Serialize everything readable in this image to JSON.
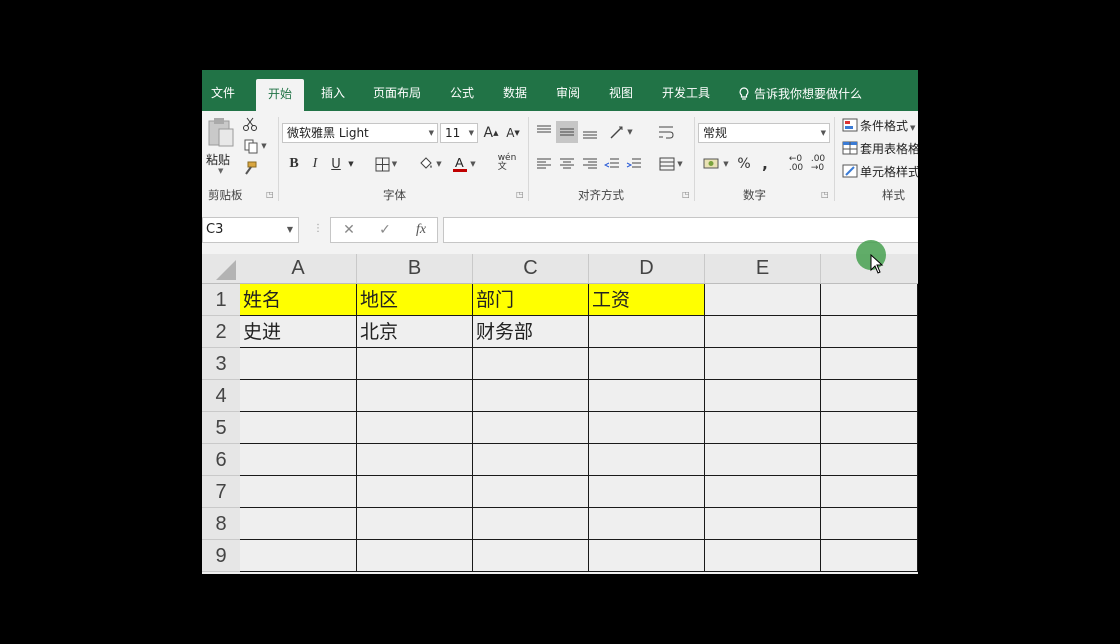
{
  "tabs": [
    {
      "label": "文件",
      "active": false
    },
    {
      "label": "开始",
      "active": true
    },
    {
      "label": "插入",
      "active": false
    },
    {
      "label": "页面布局",
      "active": false
    },
    {
      "label": "公式",
      "active": false
    },
    {
      "label": "数据",
      "active": false
    },
    {
      "label": "审阅",
      "active": false
    },
    {
      "label": "视图",
      "active": false
    },
    {
      "label": "开发工具",
      "active": false
    }
  ],
  "tell_me": "告诉我你想要做什么",
  "ribbon": {
    "clipboard": {
      "paste_label": "粘贴",
      "group_label": "剪贴板"
    },
    "font": {
      "font_name": "微软雅黑 Light",
      "font_size": "11",
      "group_label": "字体",
      "bold": "B",
      "italic": "I",
      "underline": "U"
    },
    "alignment": {
      "group_label": "对齐方式"
    },
    "number": {
      "format": "常规",
      "percent": "%",
      "comma": ",",
      "group_label": "数字"
    },
    "styles": {
      "conditional": "条件格式",
      "table": "套用表格格",
      "cell": "单元格样式",
      "group_label": "样式"
    }
  },
  "formula_bar": {
    "name_box": "C3",
    "fx": "fx",
    "formula": ""
  },
  "columns": [
    "A",
    "B",
    "C",
    "D",
    "E"
  ],
  "rows": [
    "1",
    "2",
    "3",
    "4",
    "5",
    "6",
    "7",
    "8",
    "9"
  ],
  "cells": {
    "r1": [
      "姓名",
      "地区",
      "部门",
      "工资",
      "",
      ""
    ],
    "r2": [
      "史进",
      "北京",
      "财务部",
      "",
      "",
      ""
    ]
  },
  "colors": {
    "accent": "#217346",
    "header_highlight": "#ffff00"
  }
}
